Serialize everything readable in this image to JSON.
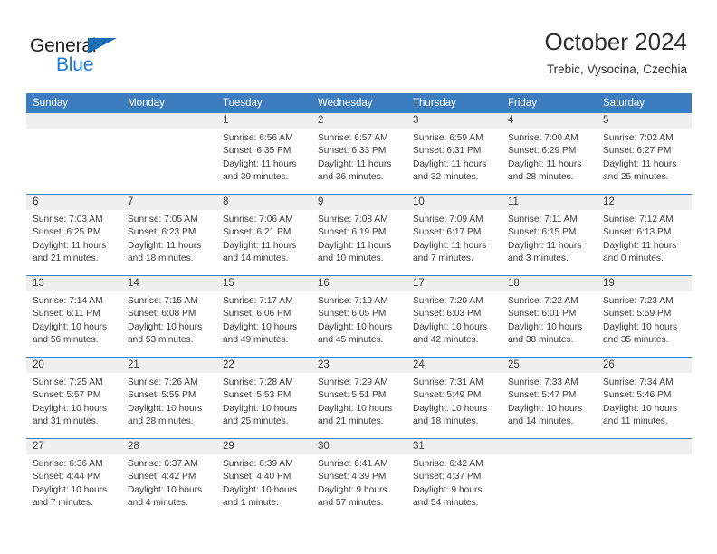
{
  "brand": {
    "name_part1": "General",
    "name_part2": "Blue",
    "triangle_color": "#1a6cb5",
    "blue_color": "#1a7ad4"
  },
  "header": {
    "title": "October 2024",
    "subtitle": "Trebic, Vysocina, Czechia"
  },
  "theme": {
    "header_blue": "#3c7cbf",
    "day_band_gray": "#efefef",
    "text_color": "#3a3a3a"
  },
  "weekdays": [
    "Sunday",
    "Monday",
    "Tuesday",
    "Wednesday",
    "Thursday",
    "Friday",
    "Saturday"
  ],
  "weeks": [
    [
      {
        "day": "",
        "lines": []
      },
      {
        "day": "",
        "lines": []
      },
      {
        "day": "1",
        "lines": [
          "Sunrise: 6:56 AM",
          "Sunset: 6:35 PM",
          "Daylight: 11 hours",
          "and 39 minutes."
        ]
      },
      {
        "day": "2",
        "lines": [
          "Sunrise: 6:57 AM",
          "Sunset: 6:33 PM",
          "Daylight: 11 hours",
          "and 36 minutes."
        ]
      },
      {
        "day": "3",
        "lines": [
          "Sunrise: 6:59 AM",
          "Sunset: 6:31 PM",
          "Daylight: 11 hours",
          "and 32 minutes."
        ]
      },
      {
        "day": "4",
        "lines": [
          "Sunrise: 7:00 AM",
          "Sunset: 6:29 PM",
          "Daylight: 11 hours",
          "and 28 minutes."
        ]
      },
      {
        "day": "5",
        "lines": [
          "Sunrise: 7:02 AM",
          "Sunset: 6:27 PM",
          "Daylight: 11 hours",
          "and 25 minutes."
        ]
      }
    ],
    [
      {
        "day": "6",
        "lines": [
          "Sunrise: 7:03 AM",
          "Sunset: 6:25 PM",
          "Daylight: 11 hours",
          "and 21 minutes."
        ]
      },
      {
        "day": "7",
        "lines": [
          "Sunrise: 7:05 AM",
          "Sunset: 6:23 PM",
          "Daylight: 11 hours",
          "and 18 minutes."
        ]
      },
      {
        "day": "8",
        "lines": [
          "Sunrise: 7:06 AM",
          "Sunset: 6:21 PM",
          "Daylight: 11 hours",
          "and 14 minutes."
        ]
      },
      {
        "day": "9",
        "lines": [
          "Sunrise: 7:08 AM",
          "Sunset: 6:19 PM",
          "Daylight: 11 hours",
          "and 10 minutes."
        ]
      },
      {
        "day": "10",
        "lines": [
          "Sunrise: 7:09 AM",
          "Sunset: 6:17 PM",
          "Daylight: 11 hours",
          "and 7 minutes."
        ]
      },
      {
        "day": "11",
        "lines": [
          "Sunrise: 7:11 AM",
          "Sunset: 6:15 PM",
          "Daylight: 11 hours",
          "and 3 minutes."
        ]
      },
      {
        "day": "12",
        "lines": [
          "Sunrise: 7:12 AM",
          "Sunset: 6:13 PM",
          "Daylight: 11 hours",
          "and 0 minutes."
        ]
      }
    ],
    [
      {
        "day": "13",
        "lines": [
          "Sunrise: 7:14 AM",
          "Sunset: 6:11 PM",
          "Daylight: 10 hours",
          "and 56 minutes."
        ]
      },
      {
        "day": "14",
        "lines": [
          "Sunrise: 7:15 AM",
          "Sunset: 6:08 PM",
          "Daylight: 10 hours",
          "and 53 minutes."
        ]
      },
      {
        "day": "15",
        "lines": [
          "Sunrise: 7:17 AM",
          "Sunset: 6:06 PM",
          "Daylight: 10 hours",
          "and 49 minutes."
        ]
      },
      {
        "day": "16",
        "lines": [
          "Sunrise: 7:19 AM",
          "Sunset: 6:05 PM",
          "Daylight: 10 hours",
          "and 45 minutes."
        ]
      },
      {
        "day": "17",
        "lines": [
          "Sunrise: 7:20 AM",
          "Sunset: 6:03 PM",
          "Daylight: 10 hours",
          "and 42 minutes."
        ]
      },
      {
        "day": "18",
        "lines": [
          "Sunrise: 7:22 AM",
          "Sunset: 6:01 PM",
          "Daylight: 10 hours",
          "and 38 minutes."
        ]
      },
      {
        "day": "19",
        "lines": [
          "Sunrise: 7:23 AM",
          "Sunset: 5:59 PM",
          "Daylight: 10 hours",
          "and 35 minutes."
        ]
      }
    ],
    [
      {
        "day": "20",
        "lines": [
          "Sunrise: 7:25 AM",
          "Sunset: 5:57 PM",
          "Daylight: 10 hours",
          "and 31 minutes."
        ]
      },
      {
        "day": "21",
        "lines": [
          "Sunrise: 7:26 AM",
          "Sunset: 5:55 PM",
          "Daylight: 10 hours",
          "and 28 minutes."
        ]
      },
      {
        "day": "22",
        "lines": [
          "Sunrise: 7:28 AM",
          "Sunset: 5:53 PM",
          "Daylight: 10 hours",
          "and 25 minutes."
        ]
      },
      {
        "day": "23",
        "lines": [
          "Sunrise: 7:29 AM",
          "Sunset: 5:51 PM",
          "Daylight: 10 hours",
          "and 21 minutes."
        ]
      },
      {
        "day": "24",
        "lines": [
          "Sunrise: 7:31 AM",
          "Sunset: 5:49 PM",
          "Daylight: 10 hours",
          "and 18 minutes."
        ]
      },
      {
        "day": "25",
        "lines": [
          "Sunrise: 7:33 AM",
          "Sunset: 5:47 PM",
          "Daylight: 10 hours",
          "and 14 minutes."
        ]
      },
      {
        "day": "26",
        "lines": [
          "Sunrise: 7:34 AM",
          "Sunset: 5:46 PM",
          "Daylight: 10 hours",
          "and 11 minutes."
        ]
      }
    ],
    [
      {
        "day": "27",
        "lines": [
          "Sunrise: 6:36 AM",
          "Sunset: 4:44 PM",
          "Daylight: 10 hours",
          "and 7 minutes."
        ]
      },
      {
        "day": "28",
        "lines": [
          "Sunrise: 6:37 AM",
          "Sunset: 4:42 PM",
          "Daylight: 10 hours",
          "and 4 minutes."
        ]
      },
      {
        "day": "29",
        "lines": [
          "Sunrise: 6:39 AM",
          "Sunset: 4:40 PM",
          "Daylight: 10 hours",
          "and 1 minute."
        ]
      },
      {
        "day": "30",
        "lines": [
          "Sunrise: 6:41 AM",
          "Sunset: 4:39 PM",
          "Daylight: 9 hours",
          "and 57 minutes."
        ]
      },
      {
        "day": "31",
        "lines": [
          "Sunrise: 6:42 AM",
          "Sunset: 4:37 PM",
          "Daylight: 9 hours",
          "and 54 minutes."
        ]
      },
      {
        "day": "",
        "lines": []
      },
      {
        "day": "",
        "lines": []
      }
    ]
  ]
}
